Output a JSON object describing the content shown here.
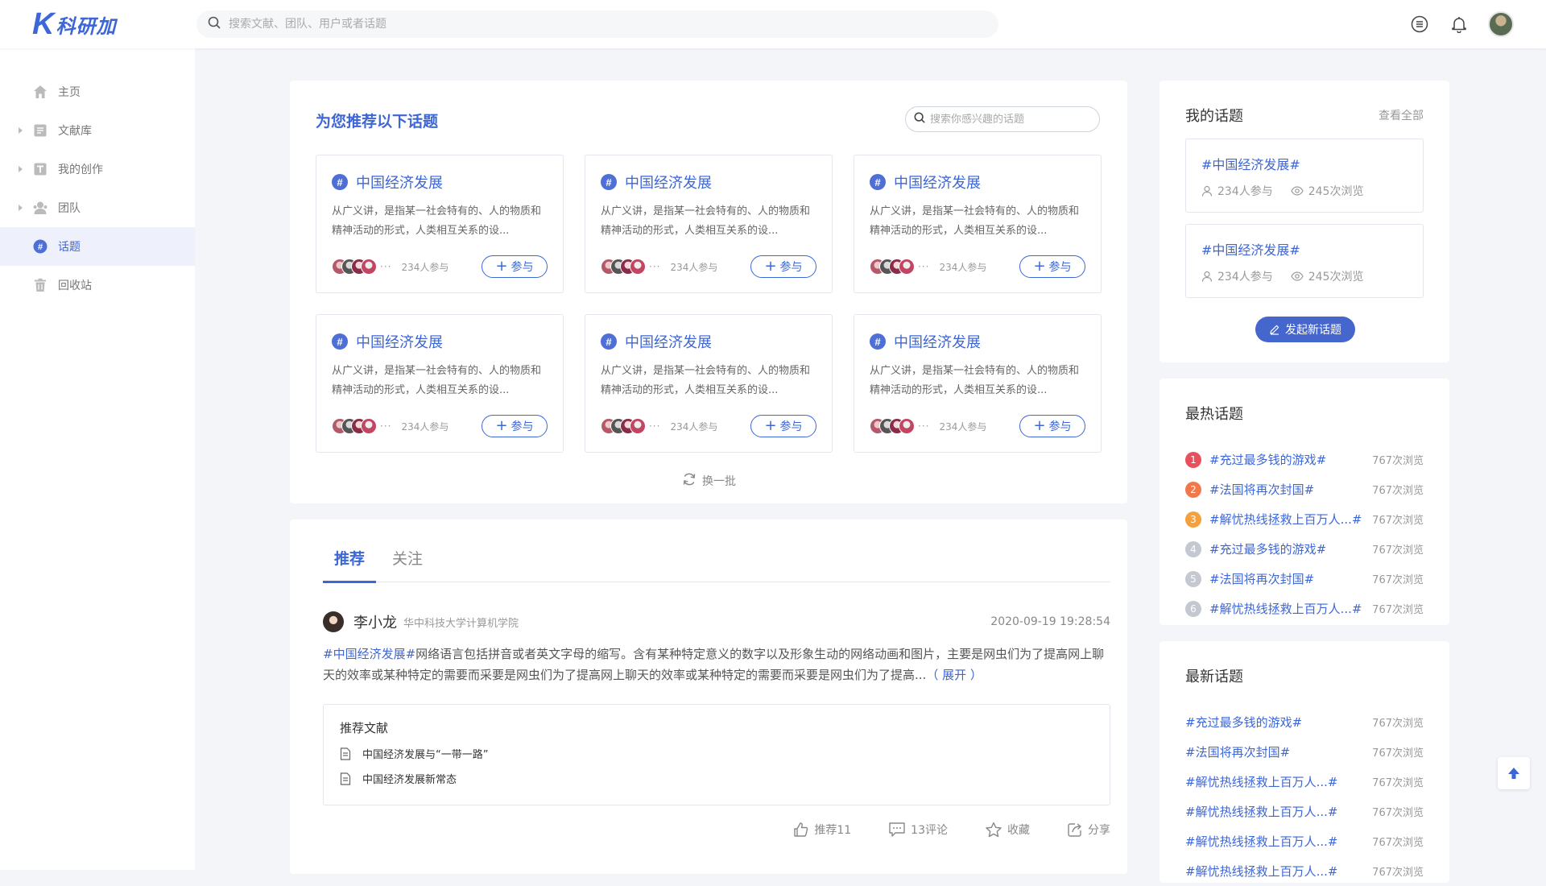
{
  "app": {
    "logo_letter": "K",
    "logo_text": "科研加",
    "brand_color": "#3d66d6"
  },
  "header": {
    "search_placeholder": "搜索文献、团队、用户或者话题",
    "icons": [
      "menu-circle-icon",
      "bell-icon",
      "user-avatar"
    ]
  },
  "sidebar": {
    "items": [
      {
        "label": "主页",
        "icon": "home-icon",
        "expandable": false,
        "active": false
      },
      {
        "label": "文献库",
        "icon": "document-icon",
        "expandable": true,
        "active": false
      },
      {
        "label": "我的创作",
        "icon": "text-t-icon",
        "expandable": true,
        "active": false
      },
      {
        "label": "团队",
        "icon": "team-icon",
        "expandable": true,
        "active": false
      },
      {
        "label": "话题",
        "icon": "hash-icon",
        "expandable": false,
        "active": true
      },
      {
        "label": "回收站",
        "icon": "trash-icon",
        "expandable": false,
        "active": false
      }
    ]
  },
  "recommend": {
    "title": "为您推荐以下话题",
    "search_placeholder": "搜索你感兴趣的话题",
    "refresh_label": "换一批",
    "topics": [
      {
        "name": "中国经济发展",
        "desc": "从广义讲，是指某一社会特有的、人的物质和精神活动的形式，人类相互关系的设...",
        "more": "···",
        "joined": "234人参与",
        "join_label": "参与"
      },
      {
        "name": "中国经济发展",
        "desc": "从广义讲，是指某一社会特有的、人的物质和精神活动的形式，人类相互关系的设...",
        "more": "···",
        "joined": "234人参与",
        "join_label": "参与"
      },
      {
        "name": "中国经济发展",
        "desc": "从广义讲，是指某一社会特有的、人的物质和精神活动的形式，人类相互关系的设...",
        "more": "···",
        "joined": "234人参与",
        "join_label": "参与"
      },
      {
        "name": "中国经济发展",
        "desc": "从广义讲，是指某一社会特有的、人的物质和精神活动的形式，人类相互关系的设...",
        "more": "···",
        "joined": "234人参与",
        "join_label": "参与"
      },
      {
        "name": "中国经济发展",
        "desc": "从广义讲，是指某一社会特有的、人的物质和精神活动的形式，人类相互关系的设...",
        "more": "···",
        "joined": "234人参与",
        "join_label": "参与"
      },
      {
        "name": "中国经济发展",
        "desc": "从广义讲，是指某一社会特有的、人的物质和精神活动的形式，人类相互关系的设...",
        "more": "···",
        "joined": "234人参与",
        "join_label": "参与"
      }
    ]
  },
  "feed": {
    "tabs": [
      {
        "label": "推荐",
        "active": true
      },
      {
        "label": "关注",
        "active": false
      }
    ],
    "post": {
      "author": "李小龙",
      "org": "华中科技大学计算机学院",
      "time": "2020-09-19 19:28:54",
      "tag": "#中国经济发展#",
      "text": "网络语言包括拼音或者英文字母的缩写。含有某种特定意义的数字以及形象生动的网络动画和图片，主要是网虫们为了提高网上聊天的效率或某种特定的需要而采要是网虫们为了提高网上聊天的效率或某种特定的需要而采要是网虫们为了提高...",
      "expand_label": "（ 展开 ）",
      "literature": {
        "title": "推荐文献",
        "items": [
          "中国经济发展与“一带一路”",
          "中国经济发展新常态"
        ]
      },
      "actions": {
        "like": "推荐11",
        "comment": "13评论",
        "favorite": "收藏",
        "share": "分享"
      }
    }
  },
  "my_topics": {
    "title": "我的话题",
    "view_all": "查看全部",
    "items": [
      {
        "name": "#中国经济发展#",
        "joined": "234人参与",
        "views": "245次浏览"
      },
      {
        "name": "#中国经济发展#",
        "joined": "234人参与",
        "views": "245次浏览"
      }
    ],
    "new_button": "发起新话题"
  },
  "hot_topics": {
    "title": "最热话题",
    "items": [
      {
        "rank": "1",
        "name": "#充过最多钱的游戏#",
        "views": "767次浏览",
        "color": "#e8505b"
      },
      {
        "rank": "2",
        "name": "#法国将再次封国#",
        "views": "767次浏览",
        "color": "#f0784a"
      },
      {
        "rank": "3",
        "name": "#解忧热线拯救上百万人...#",
        "views": "767次浏览",
        "color": "#f5a03c"
      },
      {
        "rank": "4",
        "name": "#充过最多钱的游戏#",
        "views": "767次浏览",
        "color": "#c4c8d0"
      },
      {
        "rank": "5",
        "name": "#法国将再次封国#",
        "views": "767次浏览",
        "color": "#c4c8d0"
      },
      {
        "rank": "6",
        "name": "#解忧热线拯救上百万人...#",
        "views": "767次浏览",
        "color": "#c4c8d0"
      }
    ]
  },
  "new_topics": {
    "title": "最新话题",
    "items": [
      {
        "name": "#充过最多钱的游戏#",
        "views": "767次浏览"
      },
      {
        "name": "#法国将再次封国#",
        "views": "767次浏览"
      },
      {
        "name": "#解忧热线拯救上百万人...#",
        "views": "767次浏览"
      },
      {
        "name": "#解忧热线拯救上百万人...#",
        "views": "767次浏览"
      },
      {
        "name": "#解忧热线拯救上百万人...#",
        "views": "767次浏览"
      },
      {
        "name": "#解忧热线拯救上百万人...#",
        "views": "767次浏览"
      }
    ]
  }
}
